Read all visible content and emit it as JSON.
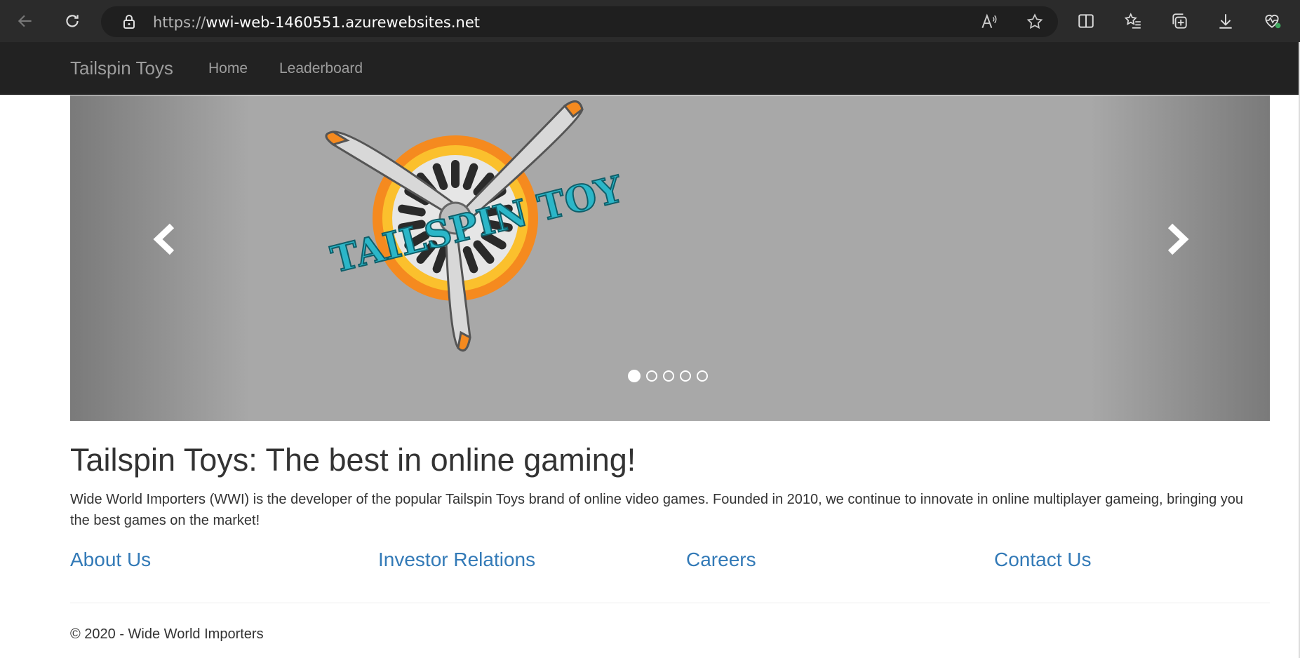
{
  "browser": {
    "url_scheme": "https://",
    "url_host": "wwi-web-1460551.azurewebsites.net",
    "icons": [
      "back-icon",
      "refresh-icon",
      "lock-icon",
      "read-aloud-icon",
      "favorite-star-icon",
      "split-screen-icon",
      "favorites-icon",
      "collections-icon",
      "downloads-icon",
      "browser-essentials-icon"
    ]
  },
  "navbar": {
    "brand": "Tailspin Toys",
    "links": [
      "Home",
      "Leaderboard"
    ]
  },
  "carousel": {
    "logo_text": "TAILSPIN TOYS",
    "slide_count": 5,
    "active_index": 0
  },
  "main": {
    "headline": "Tailspin Toys: The best in online gaming!",
    "intro": "Wide World Importers (WWI) is the developer of the popular Tailspin Toys brand of online video games. Founded in 2010, we continue to innovate in online multiplayer gameing, bringing you the best games on the market!",
    "links": [
      "About Us",
      "Investor Relations",
      "Careers",
      "Contact Us"
    ]
  },
  "footer": {
    "copyright": "© 2020 - Wide World Importers"
  },
  "colors": {
    "navbar_bg": "#222222",
    "link": "#337ab7",
    "logo_teal": "#2bb6c8",
    "logo_orange": "#f58a1f"
  }
}
